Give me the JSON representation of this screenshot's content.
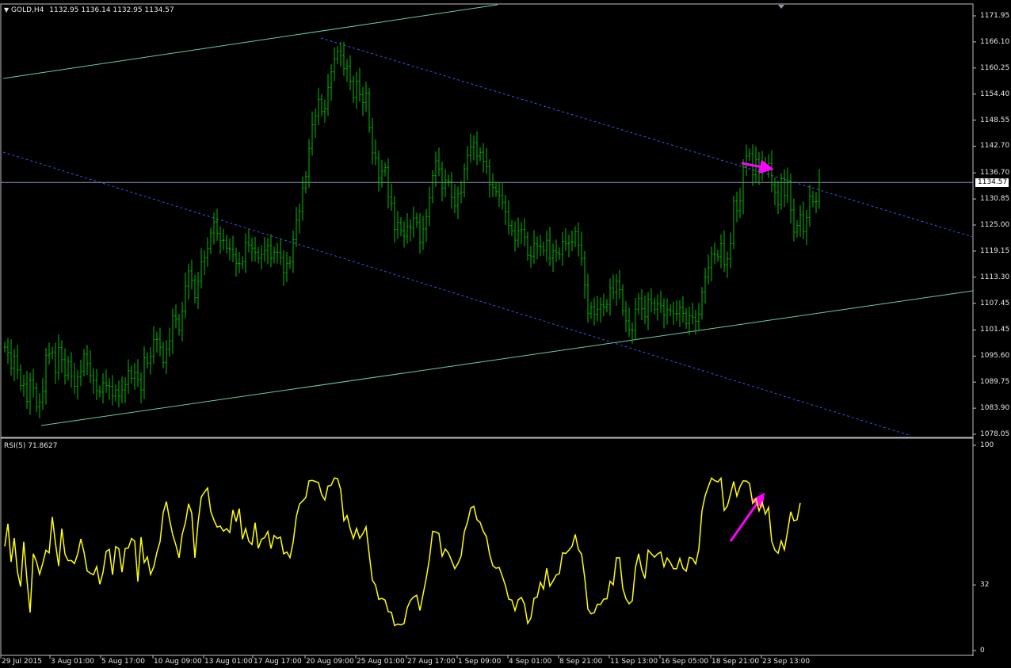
{
  "header": {
    "symbol": "GOLD,H4",
    "ohlc": "1132.95 1136.14 1132.95 1134.57"
  },
  "price_axis": {
    "ticks": [
      "1171.95",
      "1166.10",
      "1160.25",
      "1154.40",
      "1148.55",
      "1142.70",
      "1136.70",
      "1130.85",
      "1125.00",
      "1119.15",
      "1113.30",
      "1107.45",
      "1101.45",
      "1095.60",
      "1089.75",
      "1083.90",
      "1078.05"
    ],
    "current_price": "1134.57"
  },
  "rsi_panel": {
    "label": "RSI(5) 71.8627",
    "ticks": [
      "100",
      "32",
      "0"
    ]
  },
  "time_axis": {
    "ticks": [
      "29 Jul 2015",
      "3 Aug 01:00",
      "5 Aug 17:00",
      "10 Aug 09:00",
      "13 Aug 01:00",
      "17 Aug 17:00",
      "20 Aug 09:00",
      "25 Aug 01:00",
      "27 Aug 17:00",
      "1 Sep 09:00",
      "4 Sep 01:00",
      "8 Sep 21:00",
      "11 Sep 13:00",
      "16 Sep 05:00",
      "18 Sep 21:00",
      "23 Sep 13:00"
    ]
  },
  "colors": {
    "background": "#000000",
    "bars": "#00c000",
    "channel": "#66ccaa",
    "dashed": "#3355ee",
    "rsi": "#ffff00",
    "arrow": "#ff00ff",
    "grid": "#c0c0c0"
  },
  "chart_data": [
    {
      "type": "ohlc",
      "series": [
        {
          "name": "GOLD,H4",
          "close": [
            1097.6,
            1096.4,
            1092.9,
            1095.6,
            1092.5,
            1089.0,
            1089.3,
            1085.4,
            1090.2,
            1088.4,
            1084.2,
            1085.2,
            1087.7,
            1095.8,
            1096.1,
            1096.5,
            1091.9,
            1097.5,
            1094.8,
            1091.3,
            1094.4,
            1091.1,
            1088.8,
            1090.9,
            1092.2,
            1096.0,
            1093.9,
            1091.2,
            1090.1,
            1087.8,
            1087.5,
            1089.6,
            1089.0,
            1088.8,
            1086.6,
            1088.0,
            1086.6,
            1088.0,
            1089.2,
            1092.3,
            1090.6,
            1091.9,
            1090.3,
            1088.0,
            1095.2,
            1094.0,
            1095.5,
            1099.3,
            1099.4,
            1097.6,
            1094.1,
            1097.1,
            1099.0,
            1104.6,
            1103.9,
            1101.4,
            1105.7,
            1111.3,
            1114.7,
            1112.6,
            1108.7,
            1112.4,
            1116.8,
            1117.7,
            1119.7,
            1123.2,
            1125.7,
            1123.1,
            1121.5,
            1121.6,
            1119.8,
            1119.6,
            1118.3,
            1116.4,
            1116.3,
            1116.8,
            1121.0,
            1120.5,
            1119.8,
            1118.9,
            1117.6,
            1118.4,
            1119.3,
            1120.4,
            1117.6,
            1118.9,
            1118.9,
            1117.7,
            1114.3,
            1116.4,
            1116.8,
            1121.7,
            1126.1,
            1128.1,
            1133.3,
            1135.9,
            1142.2,
            1147.5,
            1149.5,
            1153.2,
            1150.5,
            1151.1,
            1155.9,
            1159.4,
            1162.3,
            1164.0,
            1163.1,
            1160.1,
            1160.6,
            1157.3,
            1153.6,
            1157.3,
            1154.3,
            1152.5,
            1154.6,
            1146.9,
            1141.2,
            1140.1,
            1135.5,
            1137.1,
            1137.9,
            1131.3,
            1129.9,
            1124.0,
            1125.6,
            1123.7,
            1122.5,
            1124.7,
            1124.3,
            1126.6,
            1125.6,
            1121.1,
            1124.1,
            1126.9,
            1131.1,
            1136.1,
            1139.4,
            1137.6,
            1133.3,
            1135.1,
            1134.8,
            1131.2,
            1129.3,
            1132.0,
            1132.4,
            1137.6,
            1140.6,
            1142.5,
            1143.5,
            1140.5,
            1141.3,
            1139.3,
            1138.1,
            1134.1,
            1133.4,
            1132.5,
            1131.6,
            1130.1,
            1128.0,
            1124.9,
            1123.7,
            1121.6,
            1123.7,
            1124.0,
            1122.3,
            1118.2,
            1118.0,
            1120.8,
            1120.3,
            1120.1,
            1119.3,
            1121.6,
            1117.5,
            1119.2,
            1118.8,
            1118.4,
            1121.3,
            1120.8,
            1121.2,
            1121.2,
            1123.5,
            1120.5,
            1117.5,
            1111.5,
            1105.2,
            1106.6,
            1105.0,
            1106.1,
            1107.1,
            1106.6,
            1107.2,
            1110.9,
            1109.9,
            1112.4,
            1110.5,
            1105.8,
            1103.5,
            1101.5,
            1101.4,
            1106.1,
            1108.5,
            1106.2,
            1104.4,
            1108.3,
            1107.5,
            1106.1,
            1107.3,
            1106.9,
            1104.8,
            1106.0,
            1105.7,
            1105.1,
            1105.1,
            1106.5,
            1105.2,
            1102.9,
            1104.6,
            1104.3,
            1103.4,
            1105.0,
            1109.9,
            1113.3,
            1115.4,
            1118.5,
            1118.3,
            1117.9,
            1120.8,
            1116.1,
            1117.4,
            1120.8,
            1130.4,
            1128.2,
            1130.4,
            1138.1,
            1140.5,
            1141.0,
            1136.3,
            1139.7,
            1137.0,
            1139.1,
            1138.1,
            1138.8,
            1134.0,
            1132.4,
            1129.6,
            1135.4,
            1131.6,
            1134.9,
            1128.4,
            1123.4,
            1124.9,
            1127.3,
            1123.5,
            1126.7,
            1131.5,
            1130.2,
            1130.3,
            1134.6
          ]
        }
      ],
      "x_ticks": [
        "29 Jul 2015",
        "3 Aug 01:00",
        "5 Aug 17:00",
        "10 Aug 09:00",
        "13 Aug 01:00",
        "17 Aug 17:00",
        "20 Aug 09:00",
        "25 Aug 01:00",
        "27 Aug 17:00",
        "1 Sep 09:00",
        "4 Sep 01:00",
        "8 Sep 21:00",
        "11 Sep 13:00",
        "16 Sep 05:00",
        "18 Sep 21:00",
        "23 Sep 13:00"
      ],
      "ylim": [
        1078.05,
        1171.95
      ],
      "y_ticks": [
        1171.95,
        1166.1,
        1160.25,
        1154.4,
        1148.55,
        1142.7,
        1136.7,
        1130.85,
        1125.0,
        1119.15,
        1113.3,
        1107.45,
        1101.45,
        1095.6,
        1089.75,
        1083.9,
        1078.05
      ],
      "current_price": 1134.57,
      "grid": false
    },
    {
      "type": "line",
      "series": [
        {
          "name": "RSI(5) 71.8627",
          "values": [
            50.8,
            61.8,
            43.2,
            54.8,
            38.5,
            31.2,
            53.0,
            34.5,
            18.5,
            47.2,
            43.4,
            37.2,
            42.6,
            48.9,
            47.6,
            65.1,
            52.3,
            41.2,
            59.4,
            47.0,
            43.8,
            43.9,
            42.4,
            46.9,
            54.4,
            48.0,
            38.8,
            37.7,
            37.0,
            40.9,
            32.3,
            38.1,
            48.3,
            49.3,
            36.9,
            50.7,
            49.6,
            38.2,
            49.7,
            50.0,
            54.6,
            53.3,
            33.6,
            55.3,
            42.9,
            45.6,
            37.1,
            40.7,
            47.8,
            53.1,
            67.2,
            72.6,
            63.8,
            56.4,
            51.4,
            45.2,
            56.7,
            62.3,
            71.5,
            66.9,
            45.2,
            62.5,
            74.8,
            77.2,
            79.2,
            67.8,
            63.6,
            60.2,
            60.6,
            58.2,
            59.4,
            57.5,
            68.5,
            62.8,
            69.2,
            54.3,
            59.4,
            53.3,
            51.7,
            62.3,
            49.8,
            54.2,
            55.0,
            58.0,
            49.7,
            56.1,
            54.6,
            55.3,
            47.1,
            48.0,
            45.3,
            52.8,
            65.2,
            71.4,
            72.9,
            74.6,
            82.7,
            82.9,
            82.4,
            81.9,
            75.9,
            73.4,
            80.2,
            80.5,
            84.1,
            83.8,
            78.4,
            63.3,
            65.8,
            59.4,
            54.6,
            59.5,
            54.7,
            57.0,
            60.3,
            46.9,
            34.3,
            31.9,
            25.0,
            25.4,
            24.6,
            19.0,
            18.6,
            12.2,
            12.9,
            12.5,
            13.2,
            20.9,
            24.4,
            26.1,
            26.9,
            19.5,
            27.4,
            35.3,
            44.7,
            58.1,
            57.8,
            57.0,
            46.0,
            49.5,
            47.5,
            43.8,
            39.9,
            42.4,
            46.1,
            57.8,
            62.5,
            69.4,
            70.3,
            63.8,
            62.4,
            58.0,
            55.5,
            46.8,
            41.4,
            40.1,
            40.5,
            36.2,
            31.6,
            25.1,
            24.6,
            19.5,
            24.7,
            25.9,
            22.6,
            13.3,
            15.8,
            25.5,
            26.1,
            33.3,
            30.0,
            40.1,
            31.4,
            33.9,
            36.8,
            37.5,
            47.7,
            47.3,
            48.9,
            50.8,
            56.6,
            49.3,
            47.0,
            35.5,
            20.2,
            17.9,
            18.4,
            22.6,
            22.5,
            25.1,
            25.2,
            33.8,
            32.0,
            45.2,
            45.2,
            30.4,
            25.3,
            22.8,
            24.2,
            40.4,
            47.2,
            39.4,
            35.1,
            48.9,
            47.2,
            45.5,
            47.1,
            48.0,
            40.9,
            45.1,
            42.9,
            39.9,
            39.9,
            44.9,
            40.1,
            38.7,
            45.4,
            44.9,
            42.2,
            49.4,
            68.2,
            75.5,
            79.9,
            84.0,
            82.8,
            82.2,
            84.0,
            68.3,
            70.4,
            76.3,
            82.4,
            75.2,
            79.9,
            82.7,
            82.6,
            81.4,
            71.7,
            74.0,
            68.1,
            72.2,
            66.5,
            69.8,
            53.3,
            49.0,
            47.4,
            53.4,
            49.1,
            58.0,
            67.7,
            63.2,
            63.8,
            71.9
          ]
        }
      ],
      "ylim": [
        0,
        100
      ],
      "y_ticks": [
        100,
        32,
        0
      ],
      "grid": false
    }
  ]
}
